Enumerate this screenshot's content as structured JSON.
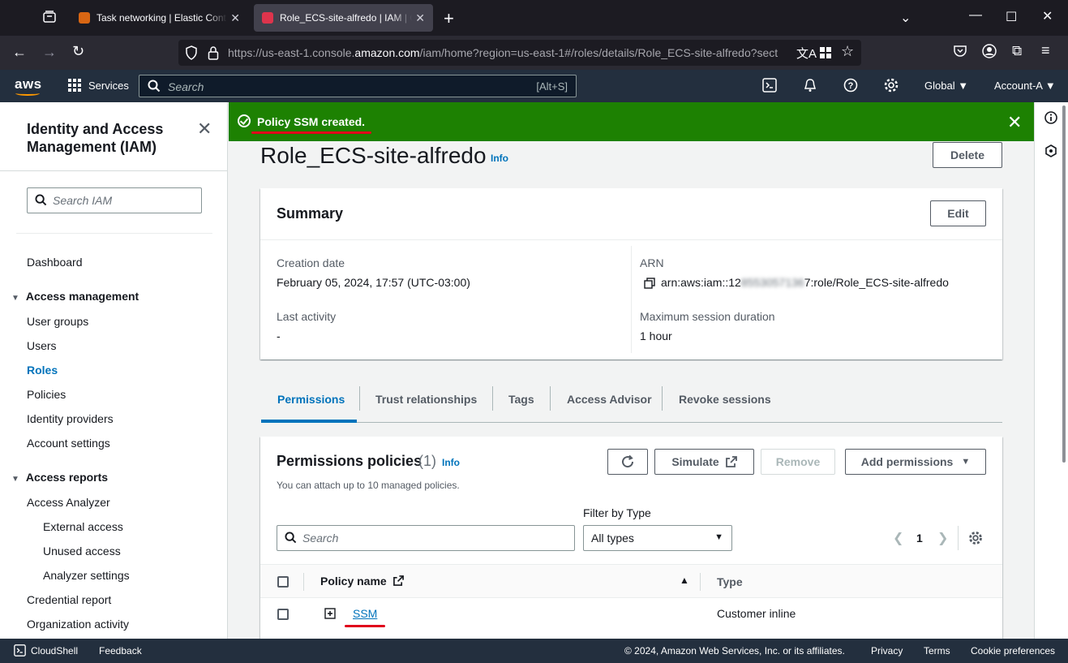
{
  "browser": {
    "tabs": [
      {
        "title": "Task networking | Elastic Contai",
        "active": false,
        "favicon_color": "#d86613"
      },
      {
        "title": "Role_ECS-site-alfredo | IAM | Glo",
        "active": true,
        "favicon_color": "#dd344c"
      }
    ],
    "url_prefix": "https://us-east-1.console.",
    "url_domain": "amazon.com",
    "url_suffix": "/iam/home?region=us-east-1#/roles/details/Role_ECS-site-alfredo?sect"
  },
  "aws_header": {
    "logo": "aws",
    "services_label": "Services",
    "search_placeholder": "Search",
    "search_hint": "[Alt+S]",
    "region": "Global",
    "account": "Account-A"
  },
  "sidebar": {
    "title": "Identity and Access Management (IAM)",
    "search_placeholder": "Search IAM",
    "dashboard": "Dashboard",
    "access_management": {
      "label": "Access management",
      "items": [
        "User groups",
        "Users",
        "Roles",
        "Policies",
        "Identity providers",
        "Account settings"
      ],
      "active": "Roles"
    },
    "access_reports": {
      "label": "Access reports",
      "items": [
        "Access Analyzer",
        "External access",
        "Unused access",
        "Analyzer settings",
        "Credential report",
        "Organization activity"
      ]
    }
  },
  "flash": {
    "message": "Policy SSM created."
  },
  "page": {
    "title": "Role_ECS-site-alfredo",
    "info": "Info",
    "delete_label": "Delete"
  },
  "summary": {
    "title": "Summary",
    "edit_label": "Edit",
    "creation_date_label": "Creation date",
    "creation_date": "February 05, 2024, 17:57 (UTC-03:00)",
    "last_activity_label": "Last activity",
    "last_activity": "-",
    "arn_label": "ARN",
    "arn_prefix": "arn:aws:iam::12",
    "arn_blurred": "8553057136",
    "arn_suffix": "7:role/Role_ECS-site-alfredo",
    "max_session_label": "Maximum session duration",
    "max_session": "1 hour"
  },
  "tabs": [
    "Permissions",
    "Trust relationships",
    "Tags",
    "Access Advisor",
    "Revoke sessions"
  ],
  "permissions": {
    "title": "Permissions policies",
    "count": "(1)",
    "info": "Info",
    "subtitle": "You can attach up to 10 managed policies.",
    "simulate_label": "Simulate",
    "remove_label": "Remove",
    "add_label": "Add permissions",
    "filter_label": "Filter by Type",
    "search_placeholder": "Search",
    "filter_value": "All types",
    "page_number": "1",
    "columns": {
      "policy_name": "Policy name",
      "type": "Type"
    },
    "rows": [
      {
        "name": "SSM",
        "type": "Customer inline"
      }
    ]
  },
  "footer": {
    "cloudshell": "CloudShell",
    "feedback": "Feedback",
    "copyright": "© 2024, Amazon Web Services, Inc. or its affiliates.",
    "privacy": "Privacy",
    "terms": "Terms",
    "cookies": "Cookie preferences"
  },
  "colors": {
    "success": "#1d8102",
    "link": "#0073bb",
    "aws_nav": "#232f3e",
    "annotation_red": "#e0001b"
  }
}
